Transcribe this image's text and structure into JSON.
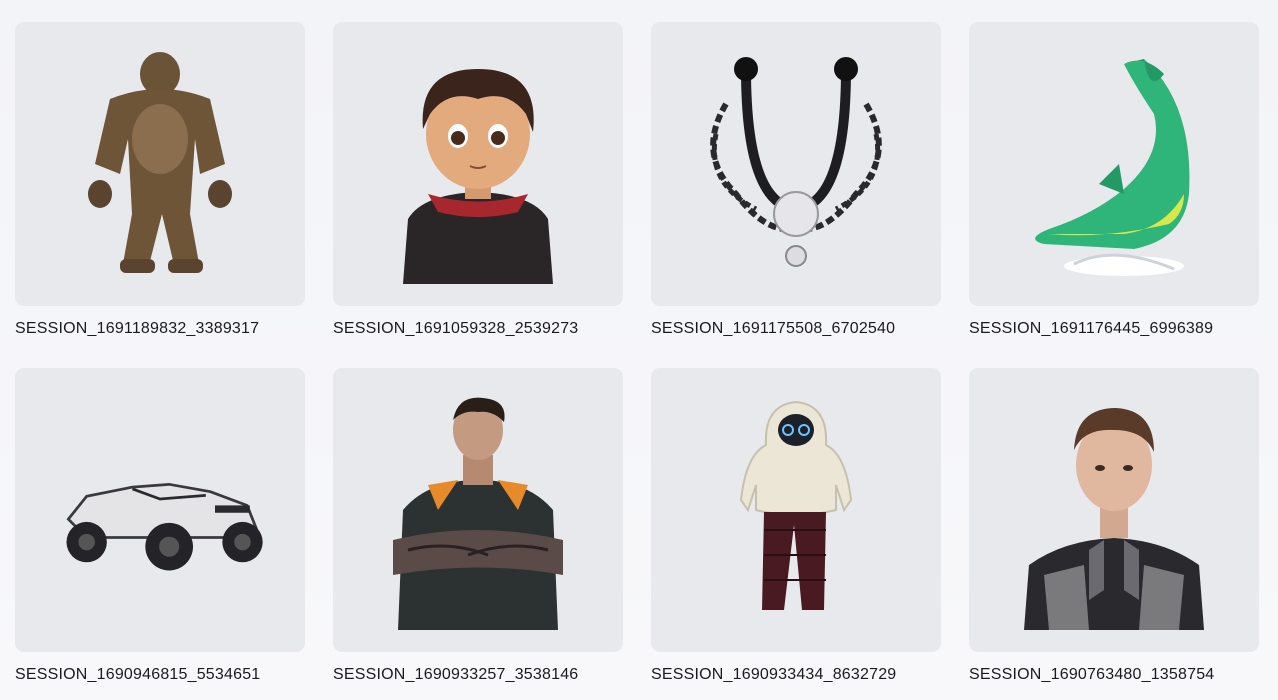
{
  "gallery": {
    "items": [
      {
        "label": "SESSION_1691189832_3389317",
        "icon": "gorilla-figure"
      },
      {
        "label": "SESSION_1691059328_2539273",
        "icon": "cartoon-boy"
      },
      {
        "label": "SESSION_1691175508_6702540",
        "icon": "septum-ring-jewelry"
      },
      {
        "label": "SESSION_1691176445_6996389",
        "icon": "dolphin-figure"
      },
      {
        "label": "SESSION_1690946815_5534651",
        "icon": "off-road-vehicle"
      },
      {
        "label": "SESSION_1690933257_3538146",
        "icon": "tattooed-man"
      },
      {
        "label": "SESSION_1690933434_8632729",
        "icon": "hooded-figure"
      },
      {
        "label": "SESSION_1690763480_1358754",
        "icon": "robot-suit-person"
      }
    ]
  }
}
